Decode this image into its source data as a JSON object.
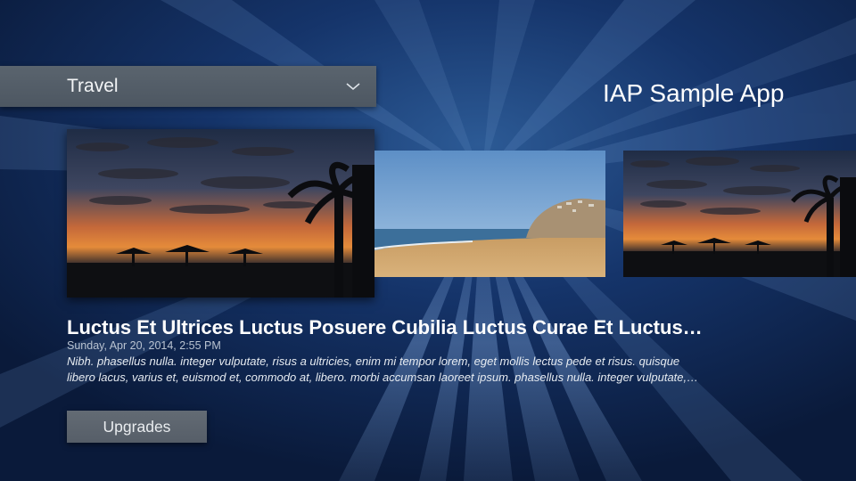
{
  "header": {
    "category_label": "Travel",
    "app_title": "IAP Sample App"
  },
  "carousel": {
    "items": [
      {
        "name": "sunset-palms",
        "selected": true
      },
      {
        "name": "beach-cliff",
        "selected": false
      },
      {
        "name": "sunset-palms",
        "selected": false
      }
    ]
  },
  "article": {
    "title": "Luctus Et Ultrices Luctus Posuere Cubilia Luctus Curae Et Luctus…",
    "date": "Sunday, Apr 20, 2014, 2:55 PM",
    "description_lines": [
      "Nibh. phasellus nulla. integer vulputate, risus a ultricies, enim mi tempor lorem, eget mollis lectus pede et risus. quisque",
      "libero lacus, varius et, euismod et, commodo at, libero. morbi accumsan laoreet ipsum. phasellus nulla. integer vulputate,…"
    ]
  },
  "actions": {
    "upgrades_label": "Upgrades"
  },
  "icons": {
    "dropdown": "chevron-down-icon"
  },
  "colors": {
    "background": "#0d2145",
    "bar": "#535d68",
    "text": "#ffffff"
  }
}
